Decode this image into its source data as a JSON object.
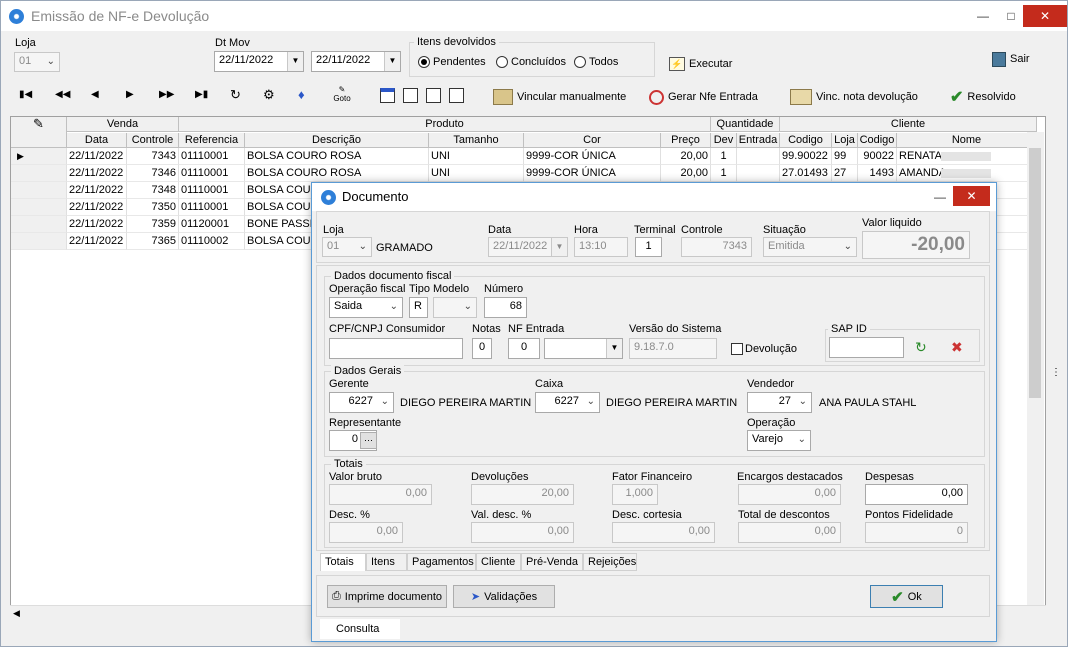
{
  "window": {
    "title": "Emissão de NF-e Devolução"
  },
  "filters": {
    "loja_label": "Loja",
    "loja_value": "01",
    "dtmov_label": "Dt Mov",
    "date_from": "22/11/2022",
    "date_to": "22/11/2022",
    "itens_label": "Itens devolvidos",
    "radio_pendentes": "Pendentes",
    "radio_concluidos": "Concluídos",
    "radio_todos": "Todos",
    "executar": "Executar",
    "sair": "Sair"
  },
  "toolbar": {
    "vincular": "Vincular manualmente",
    "gerar": "Gerar Nfe Entrada",
    "vinc_nota": "Vinc. nota devolução",
    "resolvido": "Resolvido",
    "goto": "Goto"
  },
  "grid": {
    "groups": {
      "venda": "Venda",
      "produto": "Produto",
      "quantidade": "Quantidade",
      "cliente": "Cliente"
    },
    "columns": [
      "Data",
      "Controle",
      "Referencia",
      "Descrição",
      "Tamanho",
      "Cor",
      "Preço",
      "Dev",
      "Entrada",
      "Codigo",
      "Loja",
      "Codigo",
      "Nome"
    ],
    "rows": [
      {
        "data": "22/11/2022",
        "controle": "7343",
        "ref": "01110001",
        "desc": "BOLSA COURO ROSA",
        "tam": "UNI",
        "cor": "9999-COR ÚNICA",
        "preco": "20,00",
        "dev": "1",
        "entrada": "",
        "codigo": "99.90022",
        "loja": "99",
        "ccod": "90022",
        "nome": "RENATA"
      },
      {
        "data": "22/11/2022",
        "controle": "7346",
        "ref": "01110001",
        "desc": "BOLSA COURO ROSA",
        "tam": "UNI",
        "cor": "9999-COR ÚNICA",
        "preco": "20,00",
        "dev": "1",
        "entrada": "",
        "codigo": "27.01493",
        "loja": "27",
        "ccod": "1493",
        "nome": "AMANDA"
      },
      {
        "data": "22/11/2022",
        "controle": "7348",
        "ref": "01110001",
        "desc": "BOLSA COURO",
        "tam": "",
        "cor": "",
        "preco": "",
        "dev": "",
        "entrada": "",
        "codigo": "",
        "loja": "",
        "ccod": "",
        "nome": ""
      },
      {
        "data": "22/11/2022",
        "controle": "7350",
        "ref": "01110001",
        "desc": "BOLSA COURO",
        "tam": "",
        "cor": "",
        "preco": "",
        "dev": "",
        "entrada": "",
        "codigo": "",
        "loja": "",
        "ccod": "",
        "nome": ""
      },
      {
        "data": "22/11/2022",
        "controle": "7359",
        "ref": "01120001",
        "desc": "BONE PASSEI",
        "tam": "",
        "cor": "",
        "preco": "",
        "dev": "",
        "entrada": "",
        "codigo": "",
        "loja": "",
        "ccod": "",
        "nome": ""
      },
      {
        "data": "22/11/2022",
        "controle": "7365",
        "ref": "01110002",
        "desc": "BOLSA COURO",
        "tam": "",
        "cor": "",
        "preco": "",
        "dev": "",
        "entrada": "",
        "codigo": "",
        "loja": "",
        "ccod": "",
        "nome": ""
      }
    ]
  },
  "dialog": {
    "title": "Documento",
    "loja_label": "Loja",
    "loja": "01",
    "loja_nome": "GRAMADO",
    "data_label": "Data",
    "data": "22/11/2022",
    "hora_label": "Hora",
    "hora": "13:10",
    "terminal_label": "Terminal",
    "terminal": "1",
    "controle_label": "Controle",
    "controle": "7343",
    "situacao_label": "Situação",
    "situacao": "Emitida",
    "valor_label": "Valor liquido",
    "valor": "-20,00",
    "fiscal_group": "Dados documento fiscal",
    "operacao_label": "Operação fiscal",
    "operacao": "Saida",
    "tipo_label": "Tipo",
    "tipo": "R",
    "modelo_label": "Modelo",
    "numero_label": "Número",
    "numero": "68",
    "cpf_label": "CPF/CNPJ Consumidor",
    "notas_label": "Notas",
    "notas": "0",
    "nfentrada_label": "NF Entrada",
    "nfentrada": "0",
    "versao_label": "Versão do Sistema",
    "versao": "9.18.7.0",
    "devolucao_label": "Devolução",
    "sap_label": "SAP ID",
    "gerais_group": "Dados Gerais",
    "gerente_label": "Gerente",
    "gerente": "6227",
    "gerente_nome": "DIEGO PEREIRA MARTIN",
    "caixa_label": "Caixa",
    "caixa": "6227",
    "caixa_nome": "DIEGO PEREIRA MARTIN",
    "vendedor_label": "Vendedor",
    "vendedor": "27",
    "vendedor_nome": "ANA PAULA STAHL",
    "representante_label": "Representante",
    "representante": "0",
    "operacao2_label": "Operação",
    "operacao2": "Varejo",
    "totais_group": "Totais",
    "valor_bruto_label": "Valor bruto",
    "valor_bruto": "0,00",
    "devolucoes_label": "Devoluções",
    "devolucoes": "20,00",
    "fator_label": "Fator Financeiro",
    "fator": "1,000",
    "encargos_label": "Encargos destacados",
    "encargos": "0,00",
    "despesas_label": "Despesas",
    "despesas": "0,00",
    "desc_pct_label": "Desc. %",
    "desc_pct": "0,00",
    "val_desc_label": "Val. desc. %",
    "val_desc": "0,00",
    "desc_cortesia_label": "Desc. cortesia",
    "desc_cortesia": "0,00",
    "total_desc_label": "Total de descontos",
    "total_desc": "0,00",
    "pontos_label": "Pontos Fidelidade",
    "pontos": "0",
    "tabs": [
      "Totais",
      "Itens",
      "Pagamentos",
      "Cliente",
      "Pré-Venda",
      "Rejeições"
    ],
    "imprime": "Imprime documento",
    "validacoes": "Validações",
    "ok": "Ok",
    "status": "Consulta"
  }
}
